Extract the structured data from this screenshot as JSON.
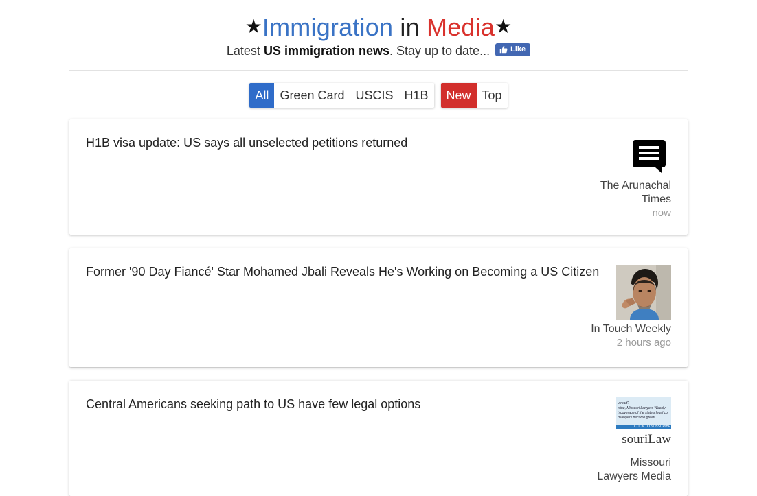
{
  "header": {
    "star_left": "★",
    "title_word1": "Immigration",
    "title_word2": "in",
    "title_word3": "Media",
    "star_right": "★",
    "subtitle_pre": "Latest ",
    "subtitle_bold": "US immigration news",
    "subtitle_post": ". Stay up to date...",
    "like_label": "Like",
    "colors": {
      "blue": "#3a73c5",
      "red": "#d9322d",
      "like_bg": "#4267b2"
    }
  },
  "filters": {
    "category_group": [
      {
        "label": "All",
        "active": true
      },
      {
        "label": "Green Card",
        "active": false
      },
      {
        "label": "USCIS",
        "active": false
      },
      {
        "label": "H1B",
        "active": false
      }
    ],
    "sort_group": [
      {
        "label": "New",
        "active": true
      },
      {
        "label": "Top",
        "active": false
      }
    ],
    "colors": {
      "active_category": "#2f6cc9",
      "active_sort": "#d22f2c"
    }
  },
  "articles": [
    {
      "title": "H1B visa update: US says all unselected petitions returned",
      "source": "The Arunachal Times",
      "time": "now",
      "thumb_icon": "speech-bubble-icon"
    },
    {
      "title": "Former '90 Day Fiancé' Star Mohamed Jbali Reveals He's Working on Becoming a US Citizen",
      "source": "In Touch Weekly",
      "time": "2 hours ago",
      "thumb_icon": "person-photo"
    },
    {
      "title": "Central Americans seeking path to US have few legal options",
      "source": "Missouri Lawyers Media",
      "time": "",
      "thumb_icon": "newspaper-ad-image",
      "thumb_text": {
        "line1": "u read?",
        "line2": "nline, Missouri Lawyers Weekly",
        "line3": "h coverage of the state's legal co",
        "line4": "d lawyers become great!",
        "cta": "CLICK TO SUBSCRIBE",
        "brand": "souriLaw"
      }
    }
  ]
}
